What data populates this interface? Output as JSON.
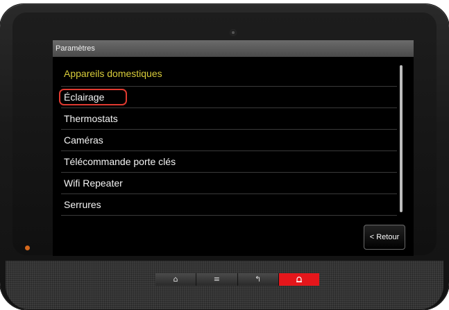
{
  "window": {
    "title": "Paramètres"
  },
  "menu": {
    "header": "Appareils domestiques",
    "items": [
      {
        "label": "Éclairage",
        "highlighted": true
      },
      {
        "label": "Thermostats"
      },
      {
        "label": "Caméras"
      },
      {
        "label": "Télécommande porte clés"
      },
      {
        "label": "Wifi Repeater"
      },
      {
        "label": "Serrures"
      }
    ]
  },
  "back_button": {
    "label": "< Retour"
  },
  "hardware_buttons": [
    {
      "icon": "home-icon",
      "glyph": "⌂"
    },
    {
      "icon": "menu-icon",
      "glyph": "≡"
    },
    {
      "icon": "back-arrow-icon",
      "glyph": "↰"
    },
    {
      "icon": "alarm-bell-icon",
      "glyph": "🔔"
    }
  ],
  "colors": {
    "header_text": "#d8cc3a",
    "highlight": "#e03a30",
    "alarm_button": "#e5161b",
    "led": "#d5681c"
  }
}
